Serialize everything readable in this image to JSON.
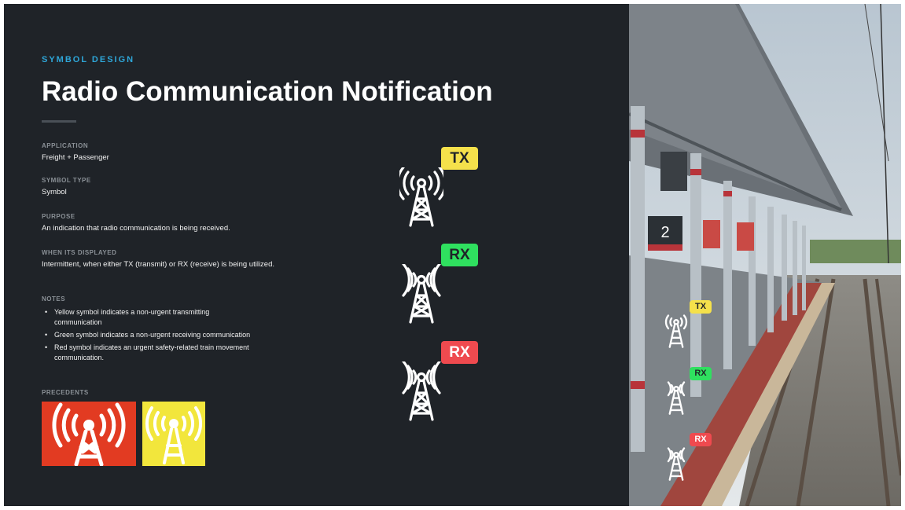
{
  "eyebrow": "SYMBOL DESIGN",
  "title": "Radio Communication Notification",
  "sections": {
    "application": {
      "label": "APPLICATION",
      "value": "Freight + Passenger"
    },
    "symbol_type": {
      "label": "SYMBOL TYPE",
      "value": "Symbol"
    },
    "purpose": {
      "label": "PURPOSE",
      "value": "An indication that radio communication is being received."
    },
    "when_displayed": {
      "label": "WHEN ITS DISPLAYED",
      "value": "Intermittent, when either TX (transmit) or RX (receive) is being utilized."
    },
    "notes": {
      "label": "NOTES",
      "items": [
        "Yellow symbol indicates a non-urgent transmitting communication",
        "Green symbol indicates a non-urgent receiving communication",
        "Red symbol indicates an urgent safety-related train movement communication."
      ]
    },
    "precedents": {
      "label": "PRECEDENTS"
    }
  },
  "precedent_icons": [
    {
      "name": "red-radio-tower-icon",
      "bg": "#e23b22",
      "fg": "#ffffff"
    },
    {
      "name": "yellow-radio-tower-icon",
      "bg": "#f2e63c",
      "fg": "#ffffff"
    }
  ],
  "symbols": [
    {
      "badge": "TX",
      "color": "#f5e14b",
      "text_color": "#1f2328"
    },
    {
      "badge": "RX",
      "color": "#2fe05f",
      "text_color": "#1f2328"
    },
    {
      "badge": "RX",
      "color": "#ef4a4f",
      "text_color": "#ffffff"
    }
  ],
  "photo": {
    "platform_sign": "2",
    "overlay_badges": [
      {
        "badge": "TX",
        "color": "#f5e14b",
        "text_color": "#1f2328"
      },
      {
        "badge": "RX",
        "color": "#2fe05f",
        "text_color": "#1f2328"
      },
      {
        "badge": "RX",
        "color": "#ef4a4f",
        "text_color": "#ffffff"
      }
    ]
  }
}
